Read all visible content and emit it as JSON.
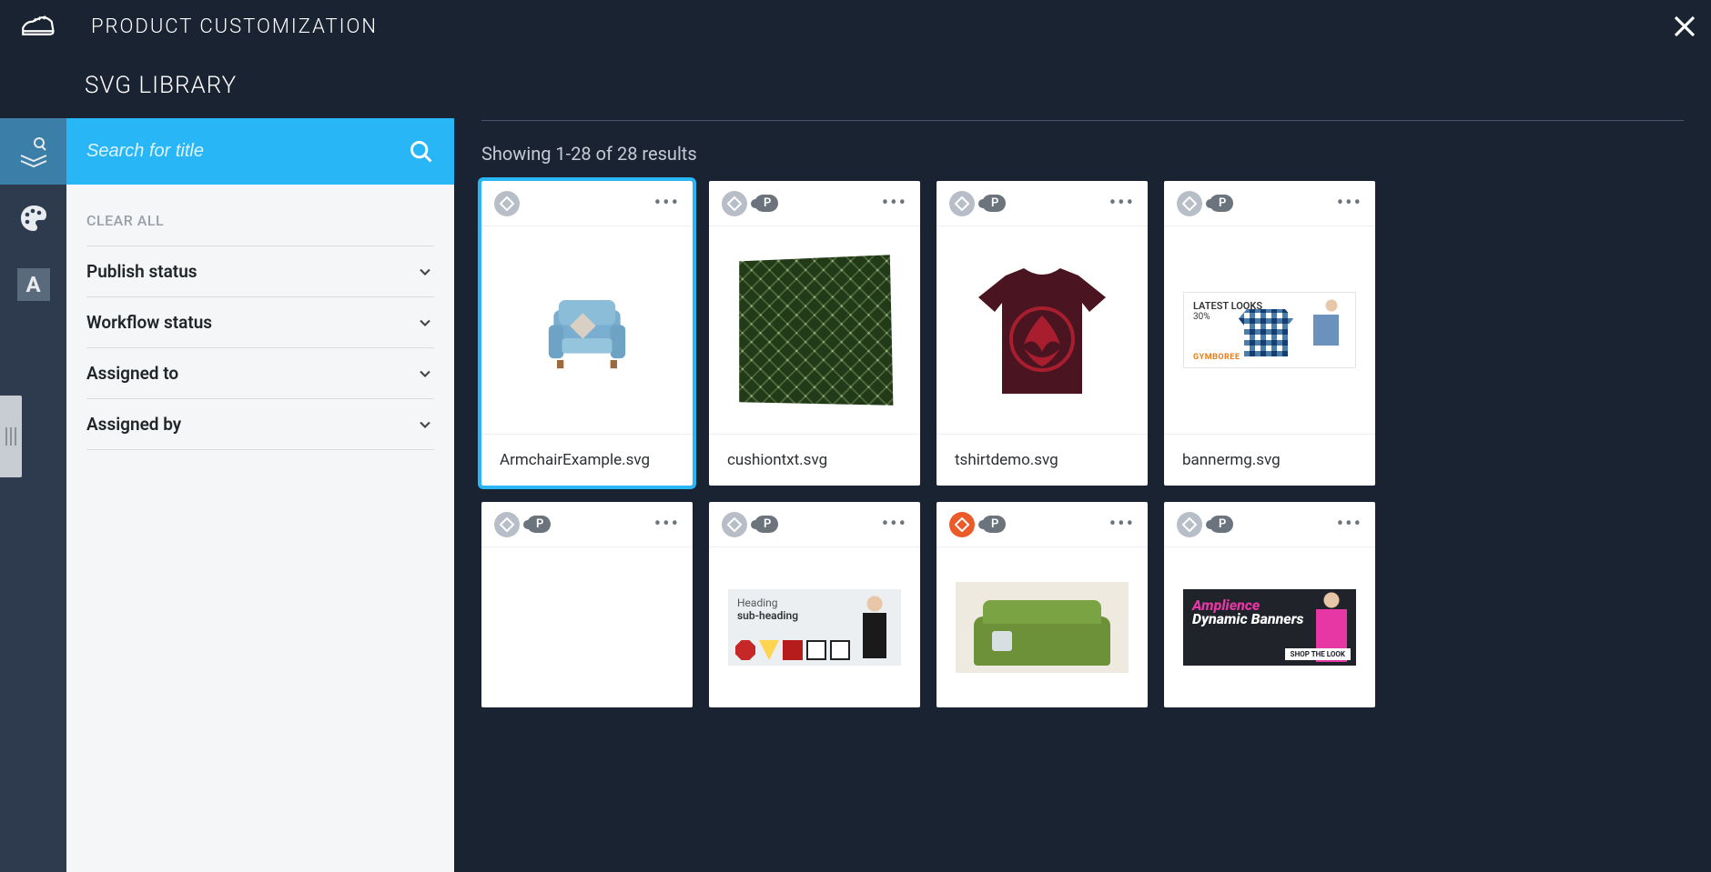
{
  "header": {
    "title": "PRODUCT CUSTOMIZATION",
    "subtitle": "SVG LIBRARY"
  },
  "search": {
    "placeholder": "Search for title"
  },
  "filters": {
    "clear_all": "CLEAR ALL",
    "items": [
      {
        "label": "Publish status"
      },
      {
        "label": "Workflow status"
      },
      {
        "label": "Assigned to"
      },
      {
        "label": "Assigned by"
      }
    ]
  },
  "results": {
    "text": "Showing 1-28 of 28 results"
  },
  "cards": [
    {
      "title": "ArmchairExample.svg",
      "selected": true,
      "p_badge": false,
      "badge_color": "gray",
      "thumb": "armchair"
    },
    {
      "title": "cushiontxt.svg",
      "selected": false,
      "p_badge": true,
      "badge_color": "gray",
      "thumb": "cushion"
    },
    {
      "title": "tshirtdemo.svg",
      "selected": false,
      "p_badge": true,
      "badge_color": "gray",
      "thumb": "tshirt"
    },
    {
      "title": "bannermg.svg",
      "selected": false,
      "p_badge": true,
      "badge_color": "gray",
      "thumb": "banner"
    },
    {
      "title": "",
      "selected": false,
      "p_badge": true,
      "badge_color": "gray",
      "thumb": "blank",
      "short": true
    },
    {
      "title": "",
      "selected": false,
      "p_badge": true,
      "badge_color": "gray",
      "thumb": "heading",
      "short": true
    },
    {
      "title": "",
      "selected": false,
      "p_badge": true,
      "badge_color": "orange",
      "thumb": "sofa",
      "short": true
    },
    {
      "title": "",
      "selected": false,
      "p_badge": true,
      "badge_color": "gray",
      "thumb": "dynamic",
      "short": true
    }
  ],
  "thumb_text": {
    "banner": {
      "line1": "LATEST LOOKS",
      "line2": "30%",
      "brand": "GYMBOREE"
    },
    "heading": {
      "h1": "Heading",
      "h2": "sub-heading"
    },
    "dynamic": {
      "t1": "Amplience",
      "t2": "Dynamic Banners",
      "btn": "SHOP THE LOOK"
    }
  },
  "badge": {
    "p_letter": "P"
  }
}
